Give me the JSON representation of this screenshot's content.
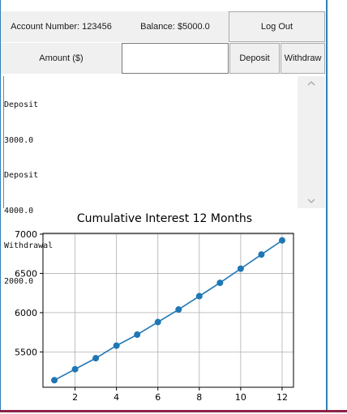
{
  "header": {
    "account_label": "Account Number: 123456",
    "balance_label": "Balance: $5000.0",
    "logout_label": "Log Out"
  },
  "form": {
    "amount_label": "Amount ($)",
    "amount_value": "",
    "deposit_label": "Deposit",
    "withdraw_label": "Withdraw"
  },
  "transactions": {
    "lines": [
      "Deposit",
      "3000.0",
      "Deposit",
      "4000.0",
      "Withdrawal",
      "2000.0"
    ]
  },
  "scrollbar": {
    "up_icon": "chevron-up-icon",
    "down_icon": "chevron-down-icon"
  },
  "colors": {
    "line": "#1f77b4",
    "window_border": "#2f7fb9",
    "bottom_border": "#8d2247"
  },
  "chart_data": {
    "type": "line",
    "title": "Cumulative Interest 12 Months",
    "xlabel": "",
    "ylabel": "",
    "x": [
      1,
      2,
      3,
      4,
      5,
      6,
      7,
      8,
      9,
      10,
      11,
      12
    ],
    "series": [
      {
        "values": [
          5140,
          5280,
          5420,
          5580,
          5720,
          5880,
          6040,
          6210,
          6380,
          6560,
          6740,
          6920
        ]
      }
    ],
    "xticks": [
      2,
      4,
      6,
      8,
      10,
      12
    ],
    "yticks": [
      5500,
      6000,
      6500,
      7000
    ],
    "xlim": [
      0.45,
      12.55
    ],
    "ylim": [
      5050,
      7010
    ],
    "grid": true
  }
}
